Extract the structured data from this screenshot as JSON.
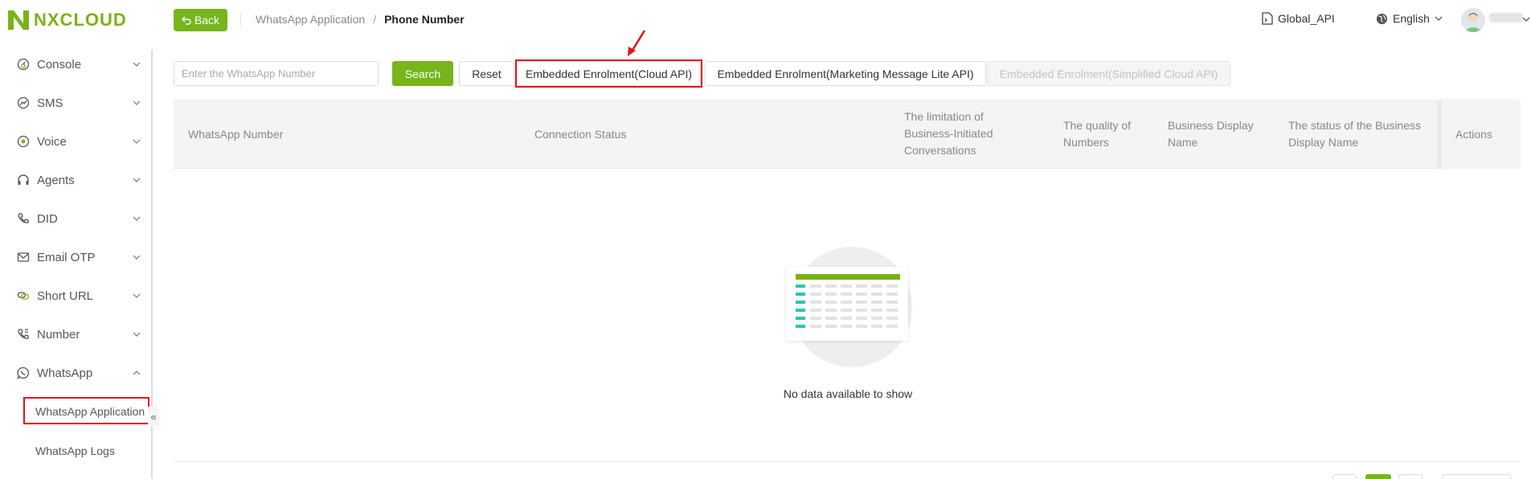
{
  "header": {
    "logo_text": "NXCLOUD",
    "back_label": "Back",
    "breadcrumb": {
      "parent": "WhatsApp Application",
      "separator": "/",
      "current": "Phone Number"
    },
    "api_label": "Global_API",
    "language": "English",
    "colors": {
      "brand": "#76b51b"
    }
  },
  "sidebar": {
    "items": [
      {
        "label": "Console",
        "icon": "console-icon",
        "expanded": false
      },
      {
        "label": "SMS",
        "icon": "sms-icon",
        "expanded": false
      },
      {
        "label": "Voice",
        "icon": "voice-icon",
        "expanded": false
      },
      {
        "label": "Agents",
        "icon": "headset-icon",
        "expanded": false
      },
      {
        "label": "DID",
        "icon": "phone-icon",
        "expanded": false
      },
      {
        "label": "Email OTP",
        "icon": "mail-icon",
        "expanded": false
      },
      {
        "label": "Short URL",
        "icon": "link-icon",
        "expanded": false
      },
      {
        "label": "Number",
        "icon": "phone-number-icon",
        "expanded": false
      },
      {
        "label": "WhatsApp",
        "icon": "whatsapp-icon",
        "expanded": true
      }
    ],
    "sub_items": [
      {
        "label": "WhatsApp Application",
        "active": true
      },
      {
        "label": "WhatsApp Logs",
        "active": false
      }
    ],
    "collapse_glyph": "«"
  },
  "toolbar": {
    "search_placeholder": "Enter the WhatsApp Number",
    "search_label": "Search",
    "reset_label": "Reset",
    "embedded_cloud_label": "Embedded Enrolment(Cloud API)",
    "embedded_marketing_label": "Embedded Enrolment(Marketing Message Lite API)",
    "embedded_simplified_label": "Embedded Enrolment(Simplified Cloud API)"
  },
  "table": {
    "columns": {
      "number": "WhatsApp Number",
      "status": "Connection Status",
      "limitation": "The limitation of Business-Initiated Conversations",
      "quality": "The quality of Numbers",
      "display_name": "Business Display Name",
      "display_status": "The status of the Business Display Name",
      "actions": "Actions"
    },
    "empty_text": "No data available to show"
  }
}
